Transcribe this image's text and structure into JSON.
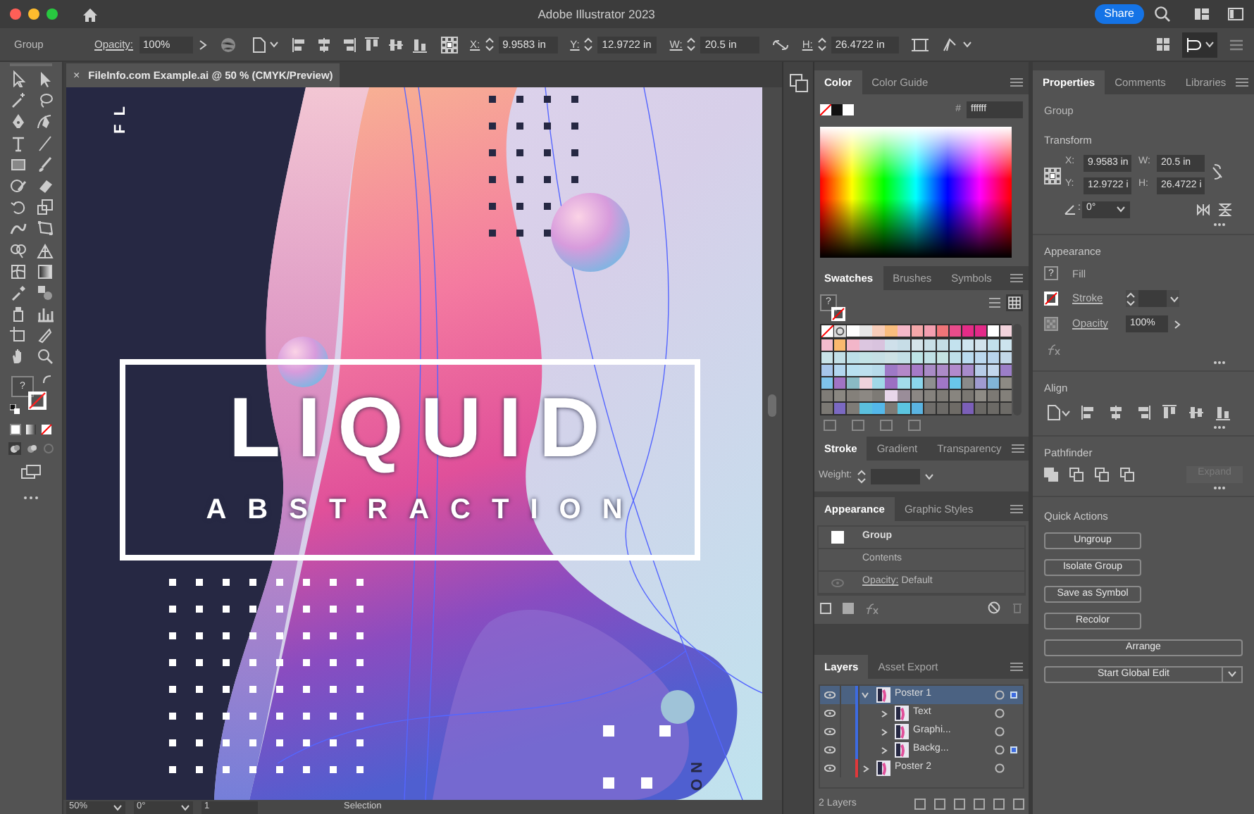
{
  "window": {
    "title": "Adobe Illustrator 2023",
    "share": "Share"
  },
  "toolbar": {
    "fill_icon": "?"
  },
  "control_bar": {
    "selection": "Group",
    "opacity_label": "Opacity:",
    "opacity": "100%",
    "x_label": "X:",
    "x": "9.9583 in",
    "y_label": "Y:",
    "y": "12.9722 in",
    "w_label": "W:",
    "w": "20.5 in",
    "h_label": "H:",
    "h": "26.4722 in"
  },
  "document_tab": {
    "close": "×",
    "title": "FileInfo.com Example.ai @ 50 % (CMYK/Preview)"
  },
  "artboard": {
    "side_text_top": "FL",
    "title": "LIQUID",
    "subtitle": "ABSTRACTION",
    "side_text_bottom": "NO"
  },
  "status_bar": {
    "zoom": "50%",
    "rotation": "0°",
    "artboard": "1",
    "tool": "Selection"
  },
  "color_panel": {
    "tabs": [
      {
        "label": "Color",
        "selected": true
      },
      {
        "label": "Color Guide",
        "selected": false
      }
    ],
    "hex_label": "#",
    "hex": "ffffff"
  },
  "swatches_panel": {
    "tabs": [
      {
        "label": "Swatches",
        "selected": true
      },
      {
        "label": "Brushes",
        "selected": false
      },
      {
        "label": "Symbols",
        "selected": false
      }
    ],
    "help": "?",
    "rows": [
      {
        "swatches": [
          {
            "color": "#ffffff"
          },
          {
            "color": "#e6e6e6"
          },
          {
            "color": "#f7cdb9"
          },
          {
            "color": "#f9bd7e"
          },
          {
            "color": "#f5b8c8"
          },
          {
            "color": "#f4a7a9"
          },
          {
            "color": "#f39fb0"
          },
          {
            "color": "#ef7478"
          },
          {
            "color": "#e84c8b"
          },
          {
            "color": "#e52c87"
          },
          {
            "color": "#e32a88"
          },
          {
            "color": "#ffffff"
          },
          {
            "color": "#f2d3dc"
          }
        ]
      },
      {
        "swatches": [
          {
            "color": "#f2bccd"
          },
          {
            "color": "#fab96e"
          },
          {
            "color": "#f3b6c9"
          },
          {
            "color": "#dcc6e0"
          },
          {
            "color": "#d9c3de"
          },
          {
            "color": "#cfe0ea"
          },
          {
            "color": "#c7dde7"
          },
          {
            "color": "#d5e4ea"
          },
          {
            "color": "#c9dfe6"
          },
          {
            "color": "#c5dde4"
          },
          {
            "color": "#c3e2ee"
          },
          {
            "color": "#cfe5ef"
          },
          {
            "color": "#d2e3ec"
          },
          {
            "color": "#c2e0ec"
          },
          {
            "color": "#cde4ee"
          }
        ]
      },
      {
        "swatches": [
          {
            "color": "#c8e3e8"
          },
          {
            "color": "#c2e0e7"
          },
          {
            "color": "#bde0e8"
          },
          {
            "color": "#c3e3e6"
          },
          {
            "color": "#c6e0e5"
          },
          {
            "color": "#cde2e5"
          },
          {
            "color": "#c3dfe6"
          },
          {
            "color": "#bde4e6"
          },
          {
            "color": "#c0e1e5"
          },
          {
            "color": "#c4e3e2"
          },
          {
            "color": "#bfdfe9"
          },
          {
            "color": "#b9dbef"
          },
          {
            "color": "#bcd9ef"
          },
          {
            "color": "#b8d4ec"
          },
          {
            "color": "#c3d8e9"
          }
        ]
      },
      {
        "swatches": [
          {
            "color": "#a7c6ea"
          },
          {
            "color": "#b2d6ef"
          },
          {
            "color": "#b8e0f0"
          },
          {
            "color": "#bde0ee"
          },
          {
            "color": "#b7dbea"
          },
          {
            "color": "#9e79c6"
          },
          {
            "color": "#b487c8"
          },
          {
            "color": "#a67ac7"
          },
          {
            "color": "#a98bc6"
          },
          {
            "color": "#ac8ac8"
          },
          {
            "color": "#b28acc"
          },
          {
            "color": "#a78bcb"
          },
          {
            "color": "#b7cde8"
          },
          {
            "color": "#c2d7ed"
          },
          {
            "color": "#9c7ec8"
          }
        ]
      },
      {
        "swatches": [
          {
            "color": "#7fc3ea"
          },
          {
            "color": "#a173c4"
          },
          {
            "color": "#8abac4"
          },
          {
            "color": "#efd3dc"
          },
          {
            "color": "#a0d8e7"
          },
          {
            "color": "#9c6fc3"
          },
          {
            "color": "#a2dcea"
          },
          {
            "color": "#8bd6ec"
          },
          {
            "color": "#8e8f90"
          },
          {
            "color": "#a077c6"
          },
          {
            "color": "#69c7ea"
          },
          {
            "color": "#8a8a8a"
          },
          {
            "color": "#9f9bd0"
          },
          {
            "color": "#81b5d7"
          },
          {
            "color": "#8d8a84"
          }
        ]
      },
      {
        "swatches": [
          {
            "color": "#7f7c77"
          },
          {
            "color": "#8a8781"
          },
          {
            "color": "#84807a"
          },
          {
            "color": "#8c8883"
          },
          {
            "color": "#7d7a75"
          },
          {
            "color": "#e8d6ea"
          },
          {
            "color": "#9a8d99"
          },
          {
            "color": "#8b8784"
          },
          {
            "color": "#85827d"
          },
          {
            "color": "#7e7b76"
          },
          {
            "color": "#88857f"
          },
          {
            "color": "#7a7772"
          },
          {
            "color": "#8e8b85"
          },
          {
            "color": "#7c7974"
          },
          {
            "color": "#83807a"
          }
        ]
      },
      {
        "swatches": [
          {
            "color": "#7b7873"
          },
          {
            "color": "#7b69c2"
          },
          {
            "color": "#7e7b76"
          },
          {
            "color": "#5bc0de"
          },
          {
            "color": "#54b8ea"
          },
          {
            "color": "#7d7a75"
          },
          {
            "color": "#5bc5e0"
          },
          {
            "color": "#5ab4e2"
          },
          {
            "color": "#6f6d6a"
          },
          {
            "color": "#6c6a67"
          },
          {
            "color": "#6e6b66"
          },
          {
            "color": "#7b5fb8"
          },
          {
            "color": "#6a6864"
          },
          {
            "color": "#6c6a66"
          },
          {
            "color": "#6d6b67"
          }
        ]
      }
    ]
  },
  "stroke_panel": {
    "tabs": [
      {
        "label": "Stroke",
        "selected": true
      },
      {
        "label": "Gradient",
        "selected": false
      },
      {
        "label": "Transparency",
        "selected": false
      }
    ],
    "weight_label": "Weight:"
  },
  "appearance_panel": {
    "tabs": [
      {
        "label": "Appearance",
        "selected": true
      },
      {
        "label": "Graphic Styles",
        "selected": false
      }
    ],
    "rows": [
      {
        "kind": "title",
        "label": "Group"
      },
      {
        "kind": "contents",
        "label": "Contents"
      },
      {
        "kind": "attribute",
        "label": "Opacity:",
        "value": "Default"
      }
    ]
  },
  "layers_panel": {
    "tabs": [
      {
        "label": "Layers",
        "selected": true
      },
      {
        "label": "Asset Export",
        "selected": false
      }
    ],
    "layers": [
      {
        "name": "Poster 1",
        "color": "#3d6be0",
        "selected": true,
        "expanded": true,
        "selected_art": true,
        "children": [
          {
            "name": "Text",
            "color": "#3d6be0",
            "selected": false,
            "expanded": false,
            "selected_art": false
          },
          {
            "name": "Graphi...",
            "color": "#3d6be0",
            "selected": false,
            "expanded": false,
            "selected_art": false
          },
          {
            "name": "Backg...",
            "color": "#3d6be0",
            "selected": false,
            "expanded": false,
            "selected_art": true
          }
        ]
      },
      {
        "name": "Poster 2",
        "color": "#e0383b",
        "selected": false,
        "expanded": false,
        "selected_art": false
      }
    ],
    "count": "2 Layers"
  },
  "properties_panel": {
    "tabs": [
      {
        "label": "Properties",
        "selected": true
      },
      {
        "label": "Comments",
        "selected": false
      },
      {
        "label": "Libraries",
        "selected": false
      }
    ],
    "selection": "Group",
    "transform": {
      "heading": "Transform",
      "x_label": "X:",
      "x": "9.9583 in",
      "w_label": "W:",
      "w": "20.5 in",
      "y_label": "Y:",
      "y": "12.9722 i",
      "h_label": "H:",
      "h": "26.4722 i",
      "angle_label": ":",
      "angle": "0°"
    },
    "appearance": {
      "heading": "Appearance",
      "fill_icon": "?",
      "fill": "Fill",
      "stroke": "Stroke",
      "opacity_label": "Opacity",
      "opacity": "100%"
    },
    "align_heading": "Align",
    "pathfinder": {
      "heading": "Pathfinder",
      "expand": "Expand",
      "expand_disabled": true
    },
    "quick_actions": {
      "heading": "Quick Actions",
      "buttons": [
        {
          "label": "Ungroup",
          "kind": "half"
        },
        {
          "label": "Isolate Group",
          "kind": "half"
        },
        {
          "label": "Save as Symbol",
          "kind": "half"
        },
        {
          "label": "Recolor",
          "kind": "half"
        },
        {
          "label": "Arrange",
          "kind": "full"
        },
        {
          "label": "Start Global Edit",
          "kind": "split"
        }
      ]
    }
  }
}
